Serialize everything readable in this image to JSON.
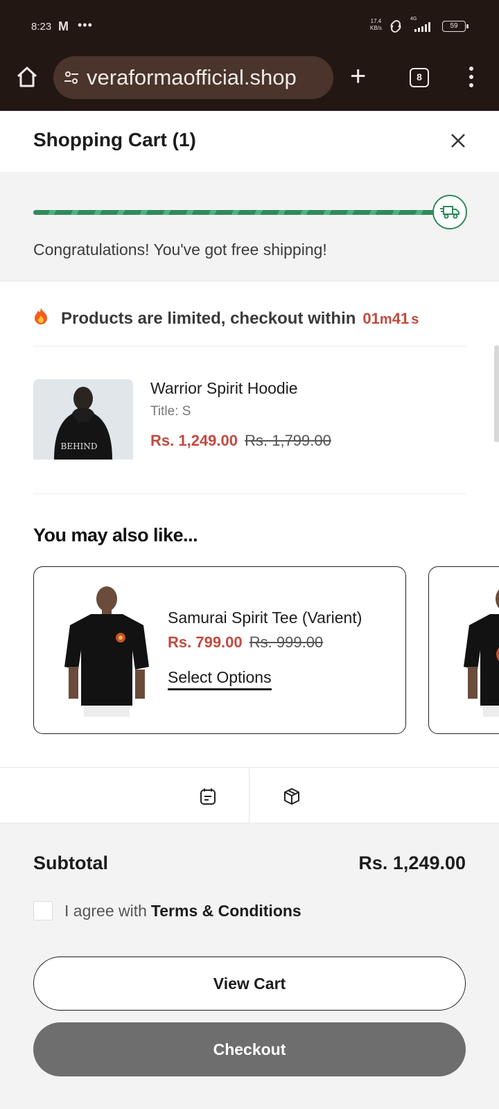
{
  "status_bar": {
    "time": "8:23",
    "speed_value": "17.4",
    "speed_unit": "KB/s",
    "network": "4G",
    "battery": "59"
  },
  "browser": {
    "url": "veraformaofficial.shop",
    "tab_count": "8"
  },
  "drawer": {
    "title": "Shopping Cart (1)"
  },
  "shipping": {
    "progress_percent": 100,
    "message": "Congratulations! You've got free shipping!"
  },
  "timer": {
    "text": "Products are limited, checkout within",
    "minutes": "01",
    "minutes_unit": "m",
    "seconds": "41",
    "seconds_unit": "s"
  },
  "cart_item": {
    "name": "Warrior Spirit Hoodie",
    "variant": "Title: S",
    "price": "Rs. 1,249.00",
    "compare_price": "Rs. 1,799.00",
    "image_text": "BEHIND"
  },
  "recommendations": {
    "title": "You may also like...",
    "items": [
      {
        "name": "Samurai Spirit Tee (Varient)",
        "price": "Rs. 799.00",
        "compare_price": "Rs. 999.00",
        "action": "Select Options"
      }
    ]
  },
  "footer": {
    "subtotal_label": "Subtotal",
    "subtotal_value": "Rs. 1,249.00",
    "terms_text": "I agree with",
    "terms_link": "Terms & Conditions",
    "view_cart": "View Cart",
    "checkout": "Checkout"
  },
  "colors": {
    "sale": "#c24a3f",
    "progress": "#2f8a5b",
    "chrome": "#231714",
    "checkout_button": "#6e6e6e"
  }
}
